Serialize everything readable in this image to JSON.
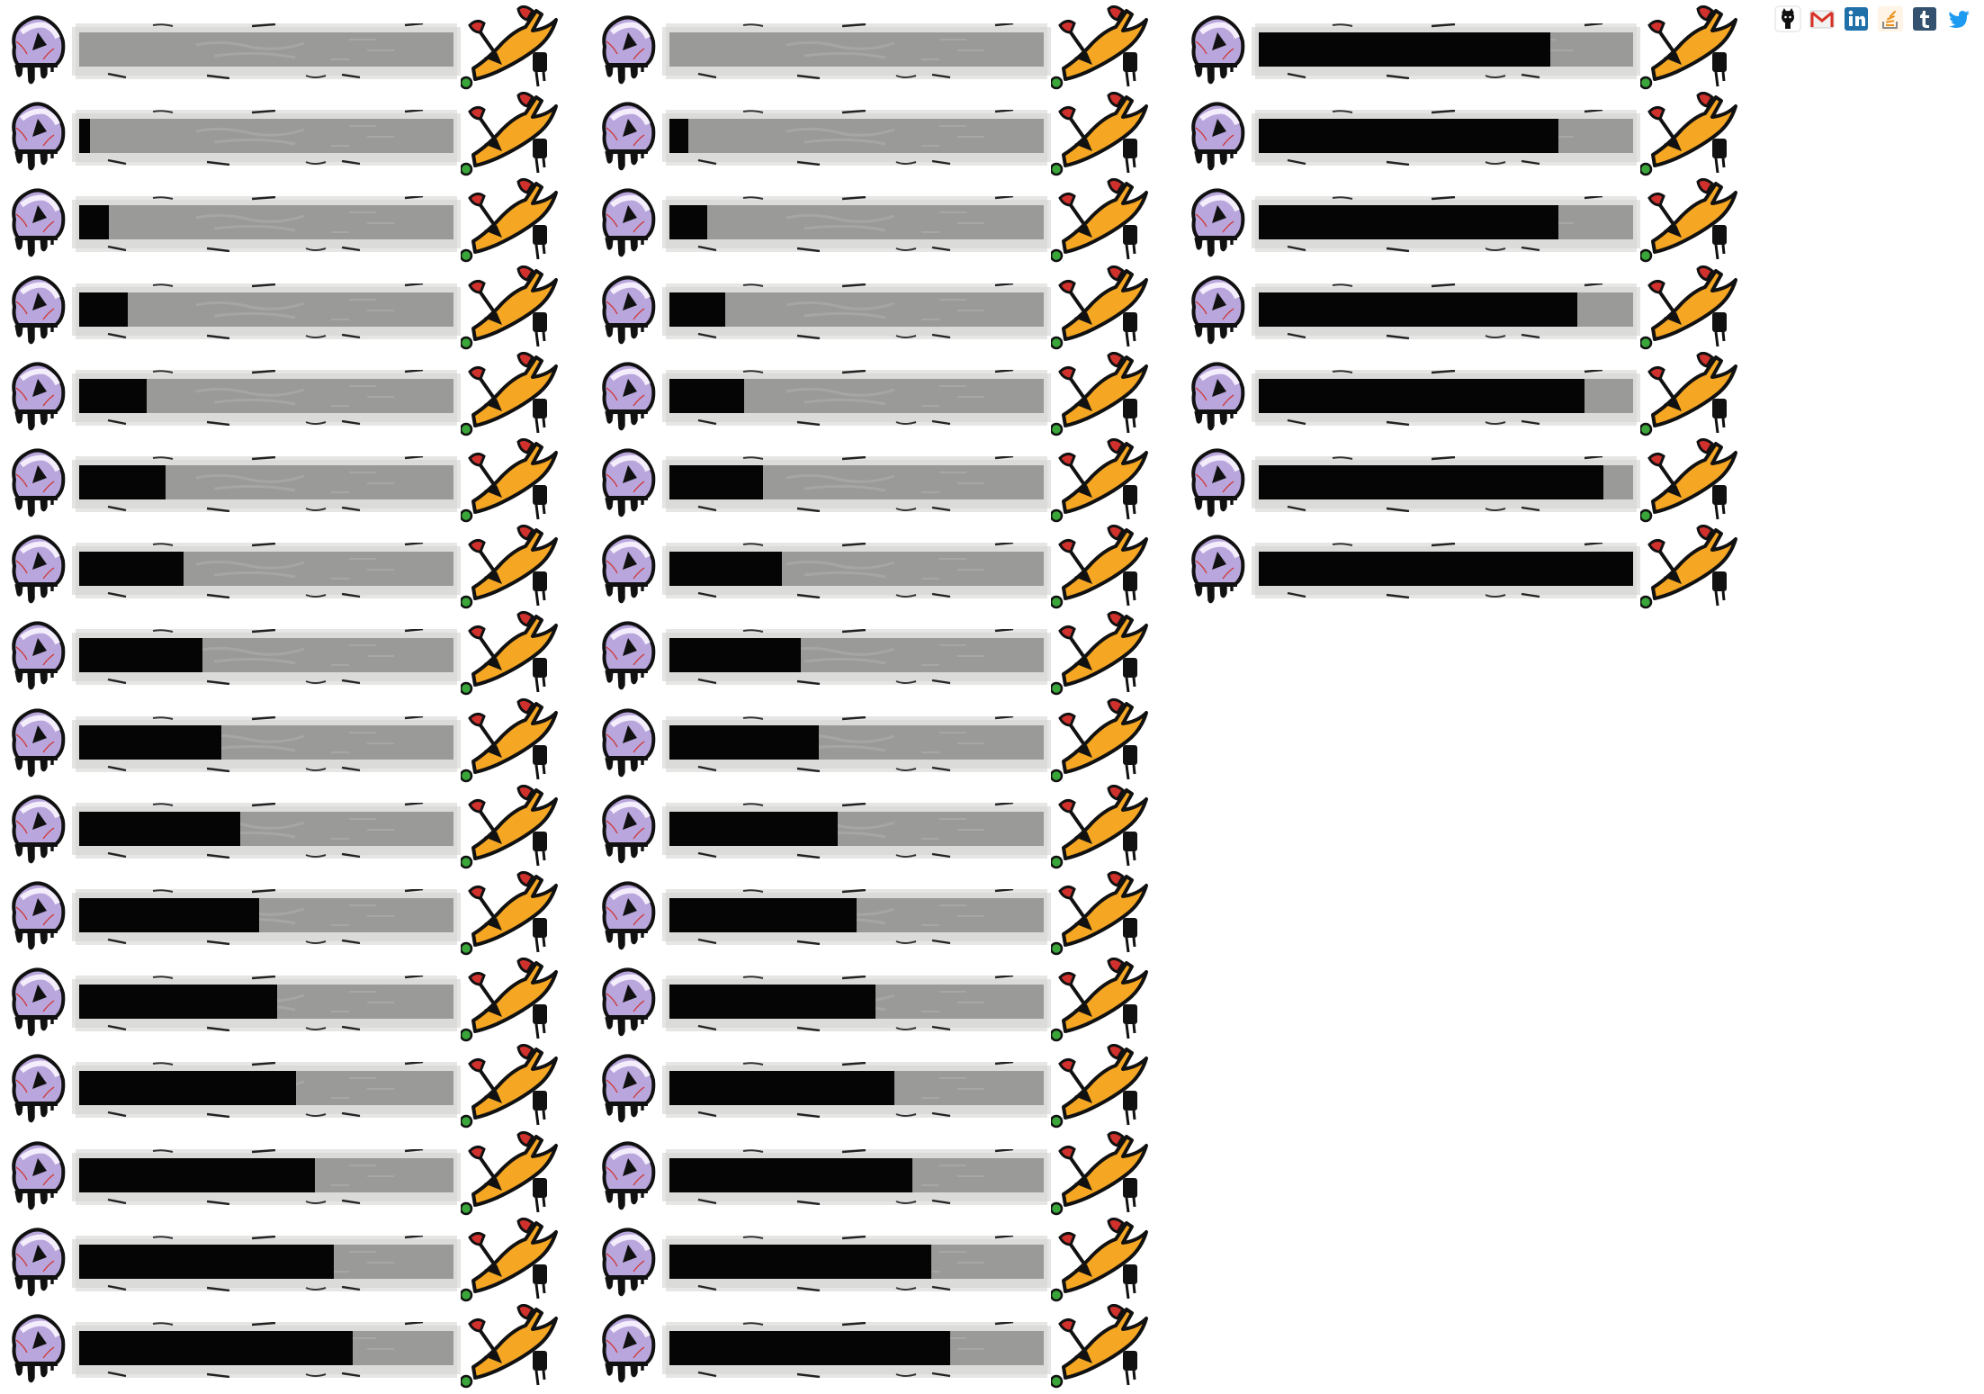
{
  "progress_bars": [
    {
      "column": 1,
      "values": [
        0,
        3,
        8,
        13,
        18,
        23,
        28,
        33,
        38,
        43,
        48,
        53,
        58,
        63,
        68,
        73
      ]
    },
    {
      "column": 2,
      "values": [
        0,
        5,
        10,
        15,
        20,
        25,
        30,
        35,
        40,
        45,
        50,
        55,
        60,
        65,
        70,
        75
      ]
    },
    {
      "column": 3,
      "values": [
        78,
        80,
        80,
        85,
        87,
        92,
        100
      ]
    }
  ],
  "social_icons": [
    {
      "name": "github-icon",
      "color": "#111111"
    },
    {
      "name": "gmail-icon",
      "color": "#d93025"
    },
    {
      "name": "linkedin-icon",
      "color": "#1f6fa8"
    },
    {
      "name": "stackoverflow-icon",
      "color": "#e8911c"
    },
    {
      "name": "tumblr-icon",
      "color": "#34526f"
    },
    {
      "name": "twitter-icon",
      "color": "#1d9bf0"
    }
  ],
  "colors": {
    "track": "#9a9a98",
    "fill": "#050505",
    "eye": "#b9a6dc",
    "blade": "#f5a623",
    "accent_red": "#d0312d",
    "dot_green": "#3aa63a"
  }
}
